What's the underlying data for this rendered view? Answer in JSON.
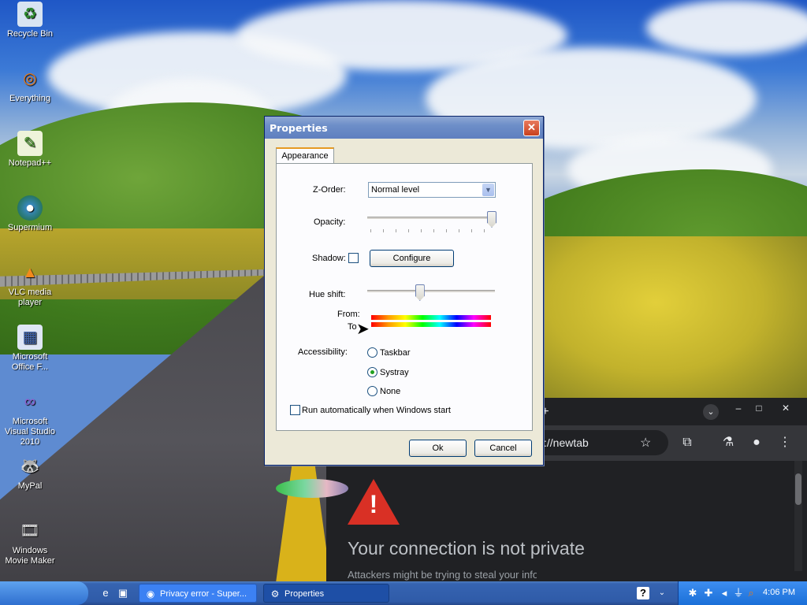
{
  "desktop": {
    "icons": [
      {
        "label": "Recycle Bin",
        "icon": "recycle-bin-icon"
      },
      {
        "label": "Everything",
        "icon": "everything-search-icon"
      },
      {
        "label": "Notepad++",
        "icon": "notepad-plus-plus-icon"
      },
      {
        "label": "Supermium",
        "icon": "supermium-browser-icon"
      },
      {
        "label": "VLC media player",
        "icon": "vlc-cone-icon"
      },
      {
        "label": "Microsoft Office F...",
        "icon": "office-icon"
      },
      {
        "label": "Microsoft Visual Studio 2010",
        "icon": "visual-studio-icon"
      },
      {
        "label": "MyPal",
        "icon": "mypal-browser-icon"
      },
      {
        "label": "Windows Movie Maker",
        "icon": "movie-maker-icon"
      }
    ]
  },
  "browser": {
    "address": "://newtab",
    "error_title": "Your connection is not private",
    "error_subtitle": "Attackers might be trying to steal your information from"
  },
  "dialog": {
    "title": "Properties",
    "tab_label": "Appearance",
    "zorder_label": "Z-Order:",
    "zorder_value": "Normal level",
    "opacity_label": "Opacity:",
    "opacity_value": 1.0,
    "shadow_label": "Shadow:",
    "shadow_checked": false,
    "configure_label": "Configure",
    "hue_label": "Hue shift:",
    "hue_value": 0.4,
    "from_label": "From:",
    "to_label": "To",
    "accessibility_label": "Accessibility:",
    "accessibility_options": [
      "Taskbar",
      "Systray",
      "None"
    ],
    "accessibility_selected": "Systray",
    "autorun_label": "Run automatically when Windows start",
    "autorun_checked": false,
    "ok_label": "Ok",
    "cancel_label": "Cancel"
  },
  "taskbar": {
    "tasks": [
      {
        "label": "Privacy error - Super...",
        "icon": "supermium-browser-icon"
      },
      {
        "label": "Properties",
        "icon": "properties-icon"
      }
    ],
    "clock": "4:06 PM"
  }
}
